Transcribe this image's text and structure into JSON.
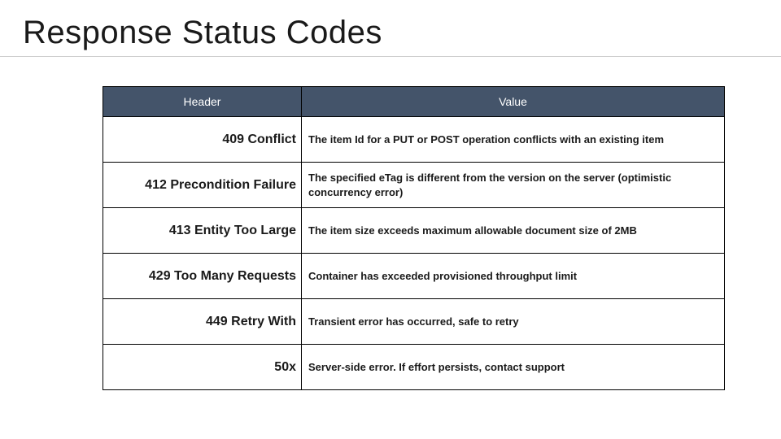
{
  "title": "Response Status Codes",
  "table": {
    "columns": {
      "header": "Header",
      "value": "Value"
    },
    "rows": [
      {
        "code": "409 Conflict",
        "desc": "The item Id for a PUT or POST operation conflicts with an existing item"
      },
      {
        "code": "412 Precondition Failure",
        "desc": "The specified eTag is different from the version on the server (optimistic concurrency error)"
      },
      {
        "code": "413 Entity Too Large",
        "desc": "The item size exceeds maximum allowable document size of 2MB"
      },
      {
        "code": "429 Too Many Requests",
        "desc": "Container has exceeded provisioned throughput limit"
      },
      {
        "code": "449 Retry With",
        "desc": "Transient error has occurred, safe to retry"
      },
      {
        "code": "50x",
        "desc": "Server-side error. If effort persists, contact support"
      }
    ]
  }
}
